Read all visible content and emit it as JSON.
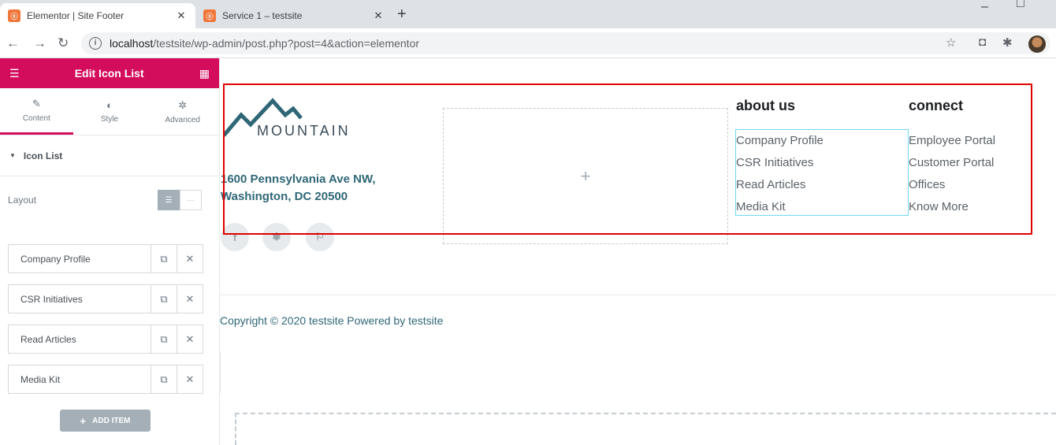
{
  "browser": {
    "tabs": [
      {
        "title": "Elementor | Site Footer",
        "favicon": "xampp-icon"
      },
      {
        "title": "Service 1 – testsite",
        "favicon": "xampp-icon"
      }
    ],
    "new_tab_glyph": "+",
    "url_host": "localhost",
    "url_path": "/testsite/wp-admin/post.php?post=4&action=elementor"
  },
  "panel": {
    "title": "Edit Icon List",
    "tabs": [
      "Content",
      "Style",
      "Advanced"
    ],
    "active_tab": "Content",
    "section_title": "Icon List",
    "layout_label": "Layout",
    "items": [
      "Company Profile",
      "CSR Initiatives",
      "Read Articles",
      "Media Kit"
    ],
    "add_item_label": "ADD ITEM",
    "accent_color": "#d30c5c"
  },
  "footer": {
    "logo_text": "MOUNTAIN",
    "address_line1": "1600 Pennsylvania Ave NW,",
    "address_line2": "Washington, DC 20500",
    "social": [
      "f",
      "✽",
      "⚐"
    ],
    "add_glyph": "+",
    "about_title": "about us",
    "about_links": [
      "Company Profile",
      "CSR Initiatives",
      "Read Articles",
      "Media Kit"
    ],
    "connect_title": "connect",
    "connect_links": [
      "Employee Portal",
      "Customer Portal",
      "Offices",
      "Know More"
    ],
    "copyright": "Copyright © 2020 testsite Powered by testsite"
  }
}
